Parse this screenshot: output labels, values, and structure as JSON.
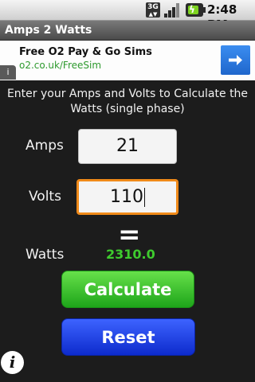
{
  "status_bar": {
    "network_label": "3G",
    "time": "2:48",
    "time_suffix": "PM",
    "icons": [
      "3g-data-icon",
      "signal-strength-icon",
      "battery-charging-icon"
    ]
  },
  "app": {
    "title": "Amps 2 Watts"
  },
  "ad": {
    "title": "Free O2 Pay & Go Sims",
    "url": "o2.co.uk/FreeSim",
    "info_glyph": "i",
    "arrow_icon": "arrow-right-icon",
    "button_color": "#2a77e0"
  },
  "calculator": {
    "instructions": "Enter your Amps and Volts to Calculate the Watts (single phase)",
    "amps_label": "Amps",
    "amps_value": "21",
    "volts_label": "Volts",
    "volts_value": "110",
    "equals": "=",
    "watts_label": "Watts",
    "watts_value": "2310.0",
    "calculate_label": "Calculate",
    "reset_label": "Reset",
    "info_glyph": "i"
  },
  "colors": {
    "background": "#1c1c1c",
    "watts_value": "#3ecb2e",
    "calculate_button": "#2fbf24",
    "reset_button": "#1a3fe6",
    "focused_field_border": "#f08a19"
  }
}
